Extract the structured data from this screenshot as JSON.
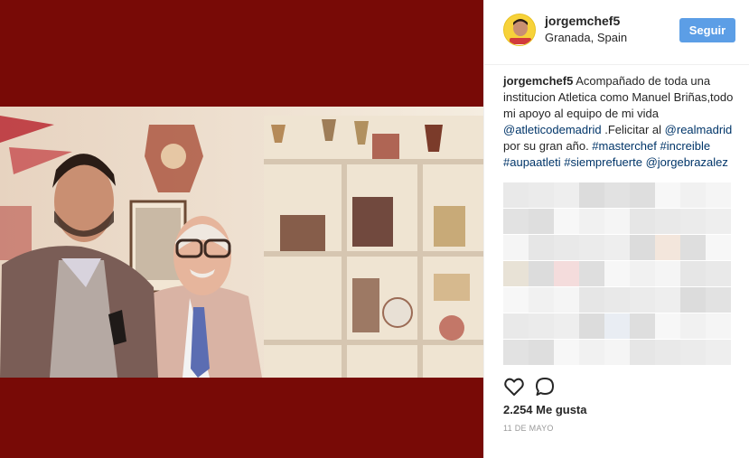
{
  "post": {
    "username": "jorgemchef5",
    "location": "Granada, Spain",
    "follow_label": "Seguir",
    "caption": {
      "username": "jorgemchef5",
      "text_1": " Acompañado de toda una institucion Atletica como Manuel Briñas,todo mi apoyo al equipo de mi vida ",
      "mention_1": "@atleticodemadrid",
      "text_2": " .Felicitar al ",
      "mention_2": "@realmadrid",
      "text_3": " por su gran año. ",
      "tag_1": "#masterchef",
      "tag_2": "#increible",
      "tag_3": "#aupaatleti",
      "tag_4": "#siemprefuerte",
      "mention_3": "@jorgebrazalez"
    },
    "likes": "2.254 Me gusta",
    "date": "11 DE MAYO"
  },
  "colors": {
    "media_background": "#780a06",
    "follow_button": "#5c9ee6",
    "link": "#003569",
    "meta_text": "#999999"
  },
  "icons": {
    "like": "heart-icon",
    "comment": "comment-icon",
    "avatar": "profile-avatar"
  }
}
